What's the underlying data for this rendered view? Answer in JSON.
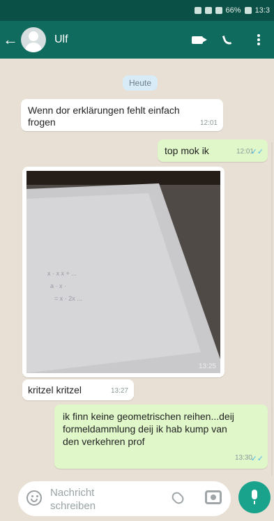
{
  "status_bar": {
    "battery": "66%",
    "time": "13:3"
  },
  "header": {
    "contact_name": "Ulf"
  },
  "date_label": "Heute",
  "messages": [
    {
      "direction": "in",
      "text": "Wenn dor erklärungen fehlt einfach frogen",
      "time": "12:01"
    },
    {
      "direction": "out",
      "text": "top mok ik",
      "time": "12:01",
      "read": true
    },
    {
      "direction": "in",
      "type": "image",
      "time": "13:25",
      "image_alt": "photo of a notebook page with handwritten formulas"
    },
    {
      "direction": "in",
      "text": "kritzel kritzel",
      "time": "13:27"
    },
    {
      "direction": "out",
      "text": "ik finn keine geometrischen reihen...deij formeldammlung deij ik hab kump van den verkehren prof",
      "time": "13:30",
      "read": true
    }
  ],
  "composer": {
    "placeholder": "Nachricht schreiben"
  },
  "colors": {
    "header": "#0f6b5d",
    "statusbar": "#0b5046",
    "outgoing": "#dff7c9",
    "incoming": "#ffffff",
    "background": "#e9e0d5",
    "fab": "#1aa38c"
  },
  "icons": [
    "back-arrow-icon",
    "avatar-icon",
    "video-call-icon",
    "voice-call-icon",
    "more-options-icon",
    "emoji-icon",
    "attach-icon",
    "camera-icon",
    "mic-icon"
  ]
}
